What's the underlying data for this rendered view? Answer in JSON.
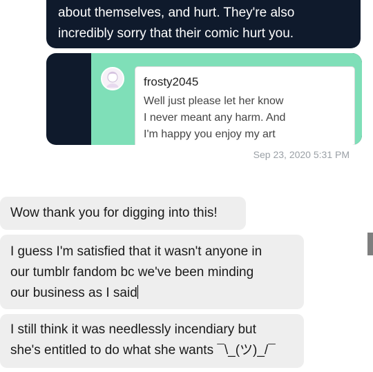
{
  "sent_message": {
    "lines": [
      "about themselves, and hurt. They're also",
      "incredibly sorry that their comic hurt you."
    ]
  },
  "embedded_post": {
    "username": "frosty2045",
    "text_lines": [
      "Well just please let her know",
      "I never meant any harm. And",
      "I'm happy you enjoy my art"
    ]
  },
  "timestamp": "Sep 23, 2020 5:31 PM",
  "received_messages": [
    {
      "lines": [
        "Wow thank you for digging into this!"
      ]
    },
    {
      "lines": [
        "I guess I'm satisfied that it wasn't anyone in",
        "our tumblr fandom bc we've been minding",
        "our business as I said"
      ]
    },
    {
      "lines": [
        "I still think it was needlessly incendiary but",
        "she's entitled to do what she wants ¯\\_(ツ)_/¯"
      ]
    }
  ],
  "colors": {
    "sent_bubble": "#0f1a2c",
    "embed_background": "#7fdfb8",
    "received_bubble": "#eeeeee"
  }
}
